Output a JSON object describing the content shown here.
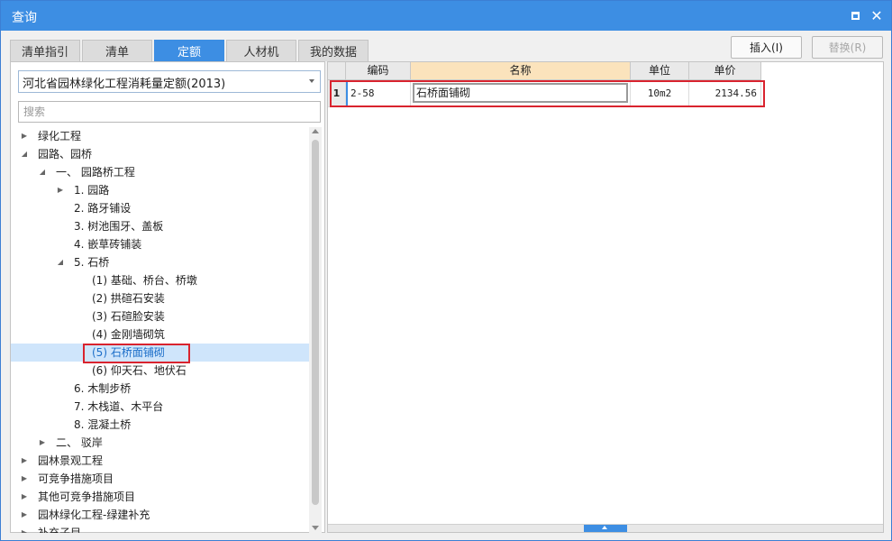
{
  "window": {
    "title": "查询"
  },
  "tabs": [
    {
      "label": "清单指引",
      "active": false
    },
    {
      "label": "清单",
      "active": false
    },
    {
      "label": "定额",
      "active": true
    },
    {
      "label": "人材机",
      "active": false
    },
    {
      "label": "我的数据",
      "active": false
    }
  ],
  "actions": {
    "insert_label": "插入(I)",
    "replace_label": "替换(R)"
  },
  "left": {
    "library_selected": "河北省园林绿化工程消耗量定额(2013)",
    "search_placeholder": "搜索"
  },
  "tree": [
    {
      "label": "绿化工程",
      "expander": "collapsed"
    },
    {
      "label": "园路、园桥",
      "expander": "expanded"
    },
    {
      "label": "一、 园路桥工程",
      "expander": "expanded"
    },
    {
      "label": "1. 园路",
      "expander": "collapsed"
    },
    {
      "label": "2. 路牙铺设",
      "expander": "none"
    },
    {
      "label": "3. 树池围牙、盖板",
      "expander": "none"
    },
    {
      "label": "4. 嵌草砖铺装",
      "expander": "none"
    },
    {
      "label": "5. 石桥",
      "expander": "expanded"
    },
    {
      "label": "(1) 基础、桥台、桥墩",
      "expander": "none"
    },
    {
      "label": "(2) 拱碹石安装",
      "expander": "none"
    },
    {
      "label": "(3) 石碹脸安装",
      "expander": "none"
    },
    {
      "label": "(4) 金刚墙砌筑",
      "expander": "none"
    },
    {
      "label": "(5) 石桥面铺砌",
      "expander": "none",
      "selected": true
    },
    {
      "label": "(6) 仰天石、地伏石",
      "expander": "none"
    },
    {
      "label": "6. 木制步桥",
      "expander": "none"
    },
    {
      "label": "7. 木栈道、木平台",
      "expander": "none"
    },
    {
      "label": "8. 混凝土桥",
      "expander": "none"
    },
    {
      "label": "二、 驳岸",
      "expander": "collapsed"
    },
    {
      "label": "园林景观工程",
      "expander": "collapsed"
    },
    {
      "label": "可竞争措施项目",
      "expander": "collapsed"
    },
    {
      "label": "其他可竞争措施项目",
      "expander": "collapsed"
    },
    {
      "label": "园林绿化工程-绿建补充",
      "expander": "collapsed"
    },
    {
      "label": "补充子目",
      "expander": "collapsed"
    }
  ],
  "grid": {
    "columns": [
      "编码",
      "名称",
      "单位",
      "单价"
    ],
    "rows": [
      {
        "num": "1",
        "code": "2-58",
        "name": "石桥面铺砌",
        "unit": "10m2",
        "price": "2134.56"
      }
    ]
  },
  "colors": {
    "accent": "#3d8ee3",
    "highlight_red": "#d9232e",
    "selection_bg": "#cfe5fb",
    "sorted_header": "#fbe3bc"
  }
}
